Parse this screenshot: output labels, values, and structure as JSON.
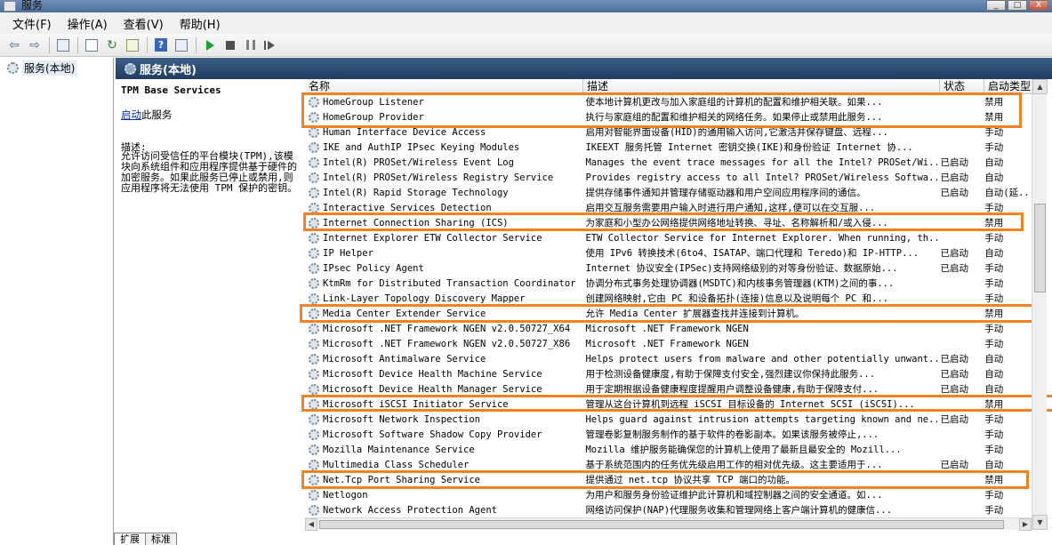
{
  "window": {
    "title": "服务",
    "minimize_glyph": "_",
    "maximize_glyph": "□",
    "close_glyph": "X"
  },
  "menu": {
    "file": "文件(F)",
    "action": "操作(A)",
    "view": "查看(V)",
    "help": "帮助(H)"
  },
  "toolbar": {
    "icons": [
      "back-arrow-icon",
      "forward-arrow-icon",
      "console-tree-icon",
      "properties-icon",
      "refresh-icon",
      "export-list-icon",
      "help-icon",
      "properties-icon-2",
      "start-icon",
      "stop-icon",
      "pause-icon",
      "restart-icon"
    ],
    "help_glyph": "?",
    "back_glyph": "⇦",
    "forward_glyph": "⇨",
    "refresh_glyph": "↻"
  },
  "tree": {
    "root": "服务(本地)"
  },
  "main_header": {
    "title": "服务(本地)"
  },
  "details": {
    "service_title": "TPM Base Services",
    "start_link": "启动",
    "start_suffix": "此服务",
    "desc_label": "描述:",
    "desc_text": "允许访问受信任的平台模块(TPM),该模块向系统组件和应用程序提供基于硬件的加密服务。如果此服务已停止或禁用,则应用程序将无法使用 TPM 保护的密钥。"
  },
  "columns": {
    "name": "名称",
    "description": "描述",
    "status": "状态",
    "startup": "启动类型"
  },
  "services": [
    {
      "name": "HomeGroup Listener",
      "description": "使本地计算机更改与加入家庭组的计算机的配置和维护相关联。如果...",
      "status": "",
      "startup": "禁用"
    },
    {
      "name": "HomeGroup Provider",
      "description": "执行与家庭组的配置和维护相关的网络任务。如果停止或禁用此服务...",
      "status": "",
      "startup": "禁用"
    },
    {
      "name": "Human Interface Device Access",
      "description": "启用对智能界面设备(HID)的通用输入访问,它激活并保存键盘、远程...",
      "status": "",
      "startup": "手动"
    },
    {
      "name": "IKE and AuthIP IPsec Keying Modules",
      "description": "IKEEXT 服务托管 Internet 密钥交换(IKE)和身份验证 Internet 协...",
      "status": "",
      "startup": "手动"
    },
    {
      "name": "Intel(R) PROSet/Wireless Event Log",
      "description": "Manages the event trace messages for all the Intel? PROSet/Wi...",
      "status": "已启动",
      "startup": "自动"
    },
    {
      "name": "Intel(R) PROSet/Wireless Registry Service",
      "description": "Provides registry access to all Intel? PROSet/Wireless Softwa...",
      "status": "已启动",
      "startup": "自动"
    },
    {
      "name": "Intel(R) Rapid Storage Technology",
      "description": "提供存储事件通知并管理存储驱动器和用户空间应用程序间的通信。",
      "status": "已启动",
      "startup": "自动(延..."
    },
    {
      "name": "Interactive Services Detection",
      "description": "启用交互服务需要用户输入时进行用户通知,这样,便可以在交互服...",
      "status": "",
      "startup": "手动"
    },
    {
      "name": "Internet Connection Sharing (ICS)",
      "description": "为家庭和小型办公网络提供网络地址转换、寻址、名称解析和/或入侵...",
      "status": "",
      "startup": "禁用"
    },
    {
      "name": "Internet Explorer ETW Collector Service",
      "description": "ETW Collector Service for Internet Explorer. When running, th...",
      "status": "",
      "startup": "手动"
    },
    {
      "name": "IP Helper",
      "description": "使用 IPv6 转换技术(6to4、ISATAP、端口代理和 Teredo)和 IP-HTTP...",
      "status": "已启动",
      "startup": "自动"
    },
    {
      "name": "IPsec Policy Agent",
      "description": "Internet 协议安全(IPSec)支持网络级别的对等身份验证、数据原始...",
      "status": "已启动",
      "startup": "手动"
    },
    {
      "name": "KtmRm for Distributed Transaction Coordinator",
      "description": "协调分布式事务处理协调器(MSDTC)和内核事务管理器(KTM)之间的事...",
      "status": "",
      "startup": "手动"
    },
    {
      "name": "Link-Layer Topology Discovery Mapper",
      "description": "创建网络映射,它由 PC 和设备拓扑(连接)信息以及说明每个 PC 和...",
      "status": "",
      "startup": "手动"
    },
    {
      "name": "Media Center Extender Service",
      "description": "允许 Media Center 扩展器查找并连接到计算机。",
      "status": "",
      "startup": "禁用"
    },
    {
      "name": "Microsoft .NET Framework NGEN v2.0.50727_X64",
      "description": "Microsoft .NET Framework NGEN",
      "status": "",
      "startup": "手动"
    },
    {
      "name": "Microsoft .NET Framework NGEN v2.0.50727_X86",
      "description": "Microsoft .NET Framework NGEN",
      "status": "",
      "startup": "手动"
    },
    {
      "name": "Microsoft Antimalware Service",
      "description": "Helps protect users from malware and other potentially unwant...",
      "status": "已启动",
      "startup": "自动"
    },
    {
      "name": "Microsoft Device Health Machine Service",
      "description": "用于检测设备健康度,有助于保障支付安全,强烈建议你保持此服务...",
      "status": "已启动",
      "startup": "自动"
    },
    {
      "name": "Microsoft Device Health Manager Service",
      "description": "用于定期根据设备健康程度提醒用户调整设备健康,有助于保障支付...",
      "status": "已启动",
      "startup": "自动"
    },
    {
      "name": "Microsoft iSCSI Initiator Service",
      "description": "管理从这台计算机到远程 iSCSI 目标设备的 Internet SCSI (iSCSI)...",
      "status": "",
      "startup": "禁用"
    },
    {
      "name": "Microsoft Network Inspection",
      "description": "Helps guard against intrusion attempts targeting known and ne...",
      "status": "已启动",
      "startup": "手动"
    },
    {
      "name": "Microsoft Software Shadow Copy Provider",
      "description": "管理卷影复制服务制作的基于软件的卷影副本。如果该服务被停止,...",
      "status": "",
      "startup": "手动"
    },
    {
      "name": "Mozilla Maintenance Service",
      "description": "Mozilla 维护服务能确保您的计算机上使用了最新且最安全的 Mozill...",
      "status": "",
      "startup": "手动"
    },
    {
      "name": "Multimedia Class Scheduler",
      "description": "基于系统范围内的任务优先级启用工作的相对优先级。这主要适用于...",
      "status": "已启动",
      "startup": "自动"
    },
    {
      "name": "Net.Tcp Port Sharing Service",
      "description": "提供通过 net.tcp 协议共享 TCP 端口的功能。",
      "status": "",
      "startup": "禁用"
    },
    {
      "name": "Netlogon",
      "description": "为用户和服务身份验证维护此计算机和域控制器之间的安全通道。如...",
      "status": "",
      "startup": "手动"
    },
    {
      "name": "Network Access Protection Agent",
      "description": "网络访问保护(NAP)代理服务收集和管理网络上客户端计算机的健康信...",
      "status": "",
      "startup": "手动"
    }
  ],
  "tabs": {
    "extended": "扩展",
    "standard": "标准"
  },
  "colors": {
    "highlight": "#f58220",
    "header_bg": "#2b4c74",
    "link": "#0033aa"
  }
}
